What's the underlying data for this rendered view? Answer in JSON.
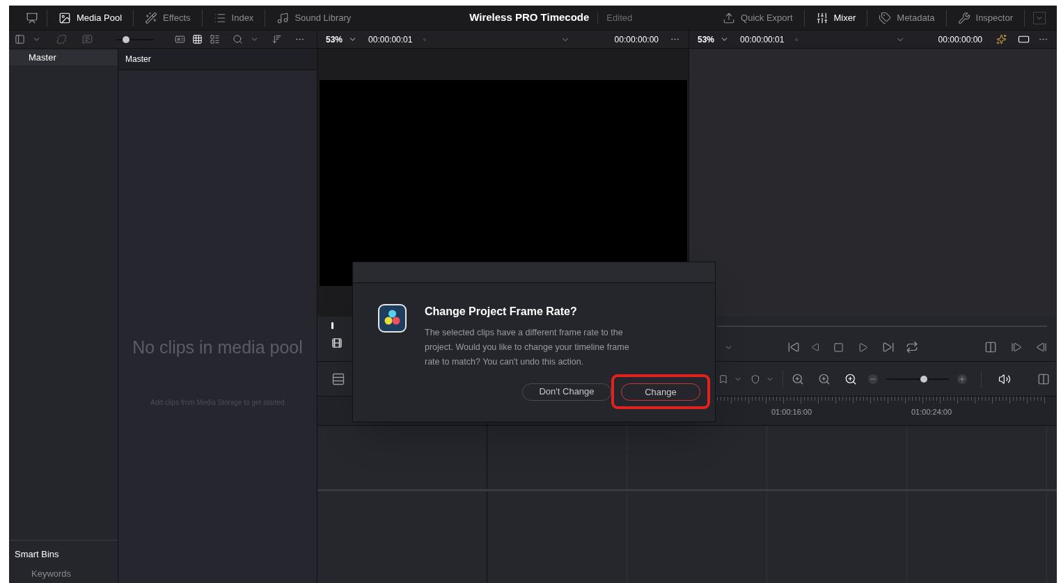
{
  "top_bar": {
    "left_tabs": [
      {
        "label": "Media Pool",
        "selected": true
      },
      {
        "label": "Effects",
        "selected": false
      },
      {
        "label": "Index",
        "selected": false
      },
      {
        "label": "Sound Library",
        "selected": false
      }
    ],
    "project_title": "Wireless PRO Timecode",
    "project_status": "Edited",
    "right_tabs": [
      {
        "label": "Quick Export",
        "selected": false
      },
      {
        "label": "Mixer",
        "selected": true
      },
      {
        "label": "Metadata",
        "selected": false
      },
      {
        "label": "Inspector",
        "selected": false
      }
    ]
  },
  "toolbar": {
    "thumbnail_size": {
      "level": 0.25
    },
    "source_zoom": "53%",
    "source_timecode": "00:00:00:01",
    "source_duration": "00:00:00:00",
    "timeline_zoom": "53%",
    "timeline_timecode": "00:00:00:01",
    "timeline_duration": "00:00:00:00"
  },
  "bins": {
    "header": "Master",
    "smart_bins": "Smart Bins",
    "smart_items": [
      "Keywords"
    ]
  },
  "media_pool": {
    "header": "Master",
    "empty_title": "No clips in media pool",
    "empty_hint": "Add clips from Media Storage to get started"
  },
  "timeline": {
    "zoom": {
      "level": 0.6
    },
    "ruler_labels": [
      "01:00:16:00",
      "01:00:24:00"
    ]
  },
  "dialog": {
    "title": "Change Project Frame Rate?",
    "message": "The selected clips have a different frame rate to the project. Would you like to change your timeline frame rate to match? You can't undo this action.",
    "buttons": [
      {
        "label": "Don't Change",
        "kind": "secondary"
      },
      {
        "label": "Change",
        "kind": "primary"
      }
    ]
  }
}
